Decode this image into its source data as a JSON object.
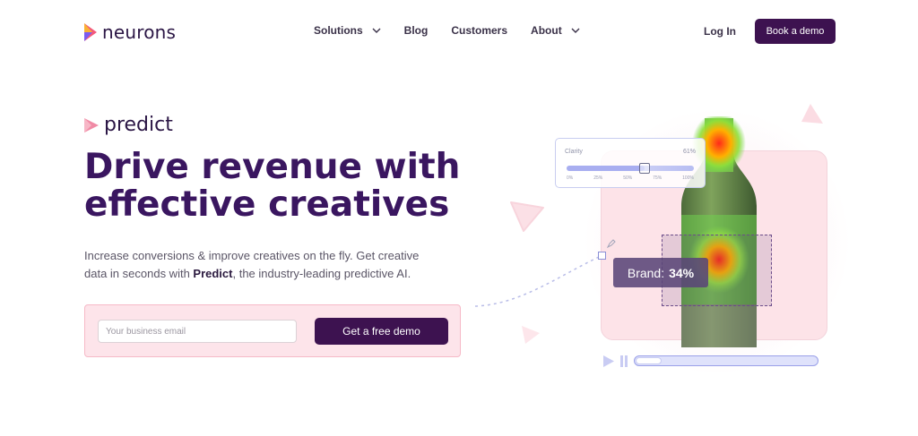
{
  "brand": {
    "name": "neurons"
  },
  "nav": {
    "items": [
      {
        "label": "Solutions",
        "dropdown": true
      },
      {
        "label": "Blog",
        "dropdown": false
      },
      {
        "label": "Customers",
        "dropdown": false
      },
      {
        "label": "About",
        "dropdown": true
      }
    ],
    "login_label": "Log In",
    "cta_label": "Book a demo"
  },
  "hero": {
    "product_name": "predict",
    "headline_line1": "Drive revenue with",
    "headline_line2": "effective creatives",
    "sub_pre": "Increase conversions & improve creatives on the fly. Get creative data in seconds with ",
    "sub_bold": "Predict",
    "sub_post": ", the industry-leading predictive AI.",
    "email_placeholder": "Your business email",
    "cta_label": "Get a free demo"
  },
  "visual": {
    "clarity_label": "Clarity",
    "clarity_value": "61%",
    "clarity_fraction": 0.61,
    "clarity_ticks": [
      "0%",
      "25%",
      "50%",
      "75%",
      "100%"
    ],
    "brand_label": "Brand:",
    "brand_value": "34%",
    "video_progress_fraction": 0.14
  },
  "colors": {
    "primary": "#3d1250",
    "headline": "#3a1660",
    "pink_bg": "#fde4ea",
    "accent_periwinkle": "#a8aef0"
  },
  "icons": {
    "logo": "neurons-logo-icon",
    "product": "predict-logo-icon",
    "dropdown": "chevron-down-icon",
    "play": "play-icon",
    "pause": "pause-icon",
    "pen": "pen-icon"
  }
}
